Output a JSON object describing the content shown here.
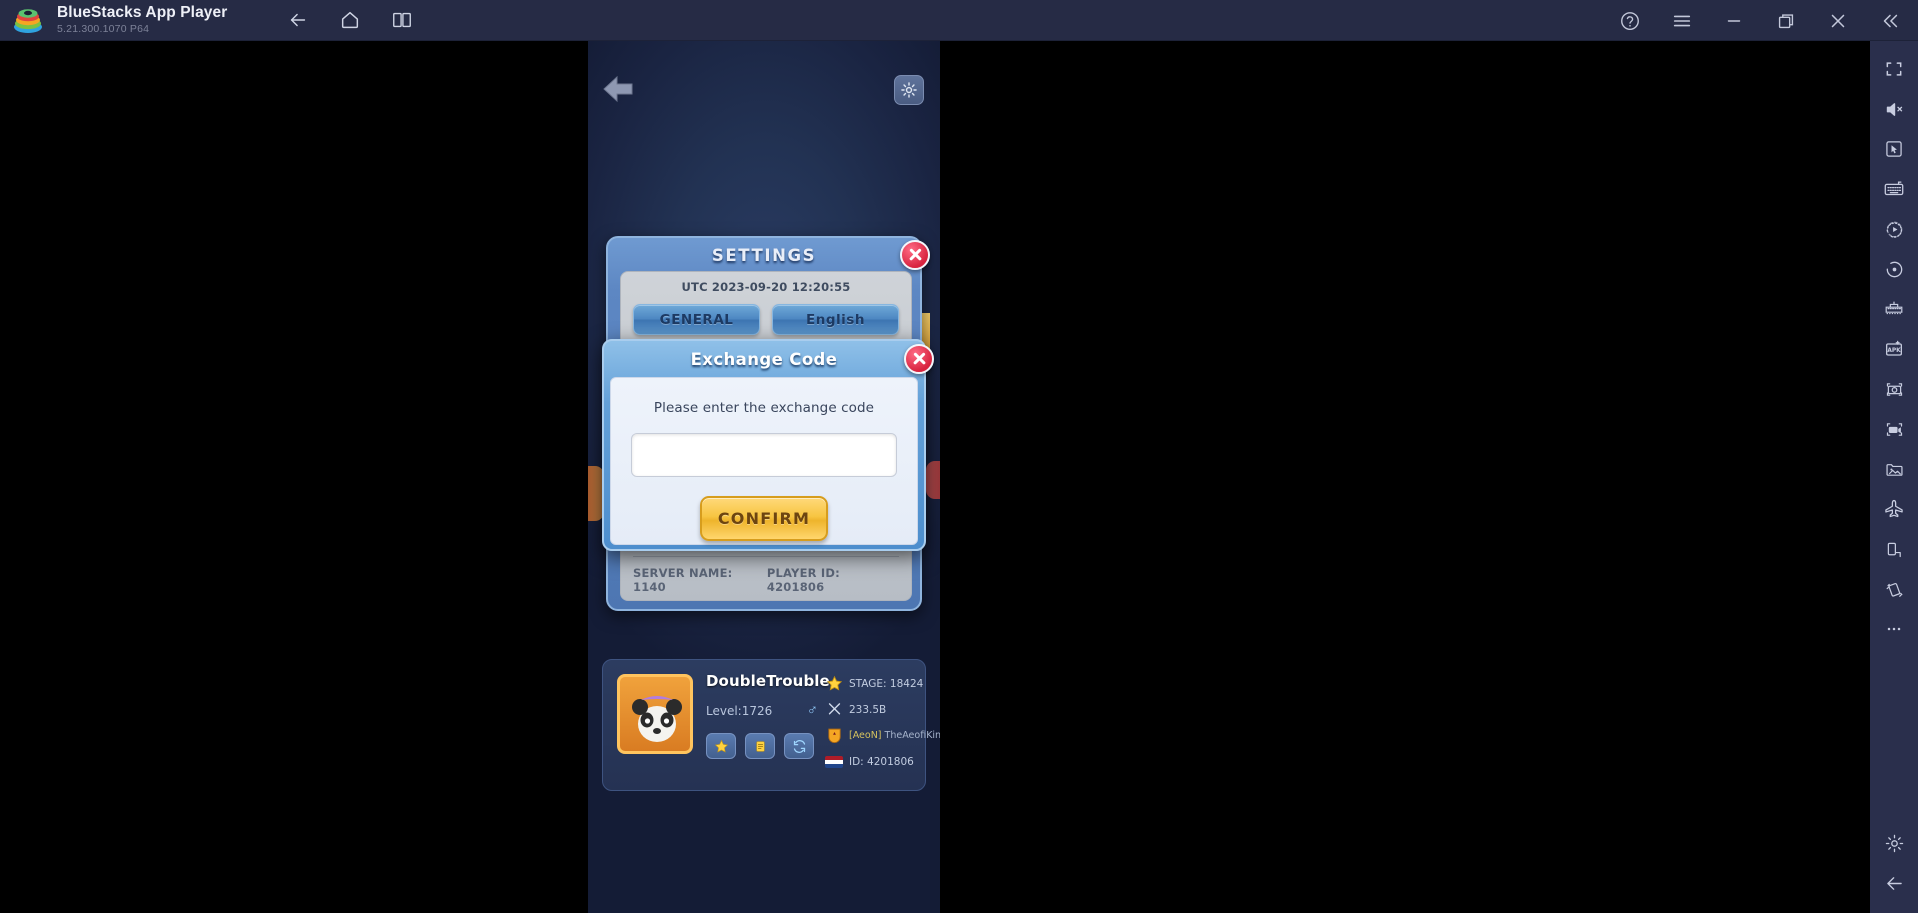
{
  "titlebar": {
    "app_name": "BlueStacks App Player",
    "version": "5.21.300.1070  P64",
    "logo_icon": "bluestacks-logo",
    "nav": [
      {
        "name": "back",
        "icon": "arrow-left-icon"
      },
      {
        "name": "home",
        "icon": "home-icon"
      },
      {
        "name": "multi-instance",
        "icon": "multi-instance-icon"
      }
    ],
    "controls": [
      {
        "name": "help",
        "icon": "question-circle-icon"
      },
      {
        "name": "menu",
        "icon": "hamburger-menu-icon"
      },
      {
        "name": "minimize",
        "icon": "minimize-icon"
      },
      {
        "name": "maximize",
        "icon": "restore-window-icon"
      },
      {
        "name": "close",
        "icon": "close-icon"
      },
      {
        "name": "collapse-sidebar",
        "icon": "double-chevron-left-icon"
      }
    ]
  },
  "sidebar": {
    "items": [
      {
        "name": "fullscreen",
        "icon": "fullscreen-icon"
      },
      {
        "name": "mute",
        "icon": "speaker-mute-icon"
      },
      {
        "name": "game-controls",
        "icon": "pointer-in-box-icon"
      },
      {
        "name": "keyboard-controls",
        "icon": "keyboard-icon"
      },
      {
        "name": "macro-recorder",
        "icon": "play-circle-icon"
      },
      {
        "name": "record-screen",
        "icon": "record-dot-icon"
      },
      {
        "name": "game-guide",
        "icon": "game-controls-icon"
      },
      {
        "name": "install-apk",
        "icon": "apk-icon"
      },
      {
        "name": "screenshot",
        "icon": "camera-icon"
      },
      {
        "name": "video-record",
        "icon": "video-camera-icon"
      },
      {
        "name": "media-manager",
        "icon": "media-folder-icon"
      },
      {
        "name": "eco-mode",
        "icon": "airplane-icon"
      },
      {
        "name": "rotate-screen",
        "icon": "rotate-device-icon"
      },
      {
        "name": "shake",
        "icon": "shake-icon"
      },
      {
        "name": "more-options",
        "icon": "ellipsis-icon"
      },
      {
        "name": "settings",
        "icon": "gear-icon"
      },
      {
        "name": "back-arrow",
        "icon": "arrow-left-icon"
      }
    ]
  },
  "game": {
    "back_icon": "back-arrow-icon",
    "gear_icon": "gear-icon",
    "settings_dialog": {
      "title": "SETTINGS",
      "close_icon": "close-icon",
      "utc_time": "UTC 2023-09-20 12:20:55",
      "buttons": [
        {
          "label": "GENERAL"
        },
        {
          "label": "English"
        }
      ],
      "server_name": "SERVER NAME: 1140",
      "player_id": "PLAYER ID: 4201806"
    },
    "exchange_dialog": {
      "title": "Exchange Code",
      "close_icon": "close-icon",
      "prompt": "Please enter the exchange code",
      "input_value": "",
      "input_placeholder": "",
      "confirm_label": "CONFIRM"
    },
    "profile": {
      "avatar_icon": "panda-avatar",
      "name": "DoubleTrouble",
      "edit_icon": "pencil-icon",
      "level": "Level:1726",
      "gender_icon": "male-symbol",
      "buttons": [
        {
          "name": "star",
          "icon": "star-icon"
        },
        {
          "name": "notes",
          "icon": "clipboard-icon"
        },
        {
          "name": "refresh",
          "icon": "refresh-icon"
        }
      ],
      "stats": [
        {
          "icon": "star-icon",
          "text": "STAGE: 18424"
        },
        {
          "icon": "swords-icon",
          "text": "233.5B"
        },
        {
          "icon": "guild-crest-icon",
          "tag": "[AeoN]",
          "text": "TheAeofiKings"
        },
        {
          "icon": "flag-nl-icon",
          "text": "ID: 4201806"
        }
      ]
    }
  },
  "colors": {
    "titlebar_bg": "#262b45",
    "sidebar_bg": "#2a2f4c",
    "dialog_blue": "#4d8ecd",
    "confirm_yellow": "#f7c542",
    "close_red": "#d8243f"
  }
}
